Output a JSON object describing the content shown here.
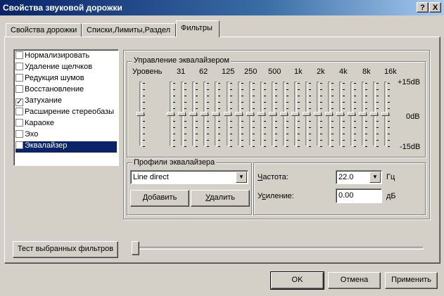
{
  "window": {
    "title": "Свойства звуковой дорожки",
    "help_button": "?",
    "close_button": "X"
  },
  "tabs": [
    {
      "label": "Свойства дорожки",
      "active": false
    },
    {
      "label": "Списки,Лимиты,Раздел",
      "active": false
    },
    {
      "label": "Фильтры",
      "active": true
    }
  ],
  "filters": [
    {
      "label": "Нормализировать",
      "checked": false
    },
    {
      "label": "Удаление щелчков",
      "checked": false
    },
    {
      "label": "Редукция шумов",
      "checked": false
    },
    {
      "label": "Восстановление",
      "checked": false
    },
    {
      "label": "Затухание",
      "checked": true
    },
    {
      "label": "Расширение стереобазы",
      "checked": false
    },
    {
      "label": "Караоке",
      "checked": false
    },
    {
      "label": "Эхо",
      "checked": false
    },
    {
      "label": "Эквалайзер",
      "checked": false,
      "selected": true
    }
  ],
  "equalizer": {
    "group_title": "Управление эквалайзером",
    "level_label": "Уровень",
    "bands": [
      "31",
      "62",
      "125",
      "250",
      "500",
      "1k",
      "2k",
      "4k",
      "8k",
      "16k"
    ],
    "scale": {
      "top": "+15dB",
      "mid": "0dB",
      "bottom": "-15dB"
    },
    "level_value_db": 0,
    "band_values_db": [
      0,
      0,
      0,
      0,
      0,
      0,
      0,
      0,
      0,
      0
    ]
  },
  "profiles": {
    "group_title": "Профили эквалайзера",
    "selected": "Line direct",
    "add_button": "Добавить",
    "add_accel": "Д",
    "add_rest": "обавить",
    "delete_button": "Удалить",
    "delete_accel": "У",
    "delete_rest": "далить"
  },
  "params": {
    "freq_label": "Частота:",
    "freq_accel": "Ч",
    "freq_rest": "астота:",
    "freq_value": "22.0",
    "freq_unit": "Гц",
    "gain_label": "Усиление:",
    "gain_pre": "У",
    "gain_accel": "с",
    "gain_rest": "иление:",
    "gain_value": "0.00",
    "gain_unit": "дБ"
  },
  "test": {
    "button_label": "Тест выбранных фильтров",
    "slider_position": 0
  },
  "footer": {
    "ok": "OK",
    "cancel": "Отмена",
    "apply": "Применить"
  }
}
